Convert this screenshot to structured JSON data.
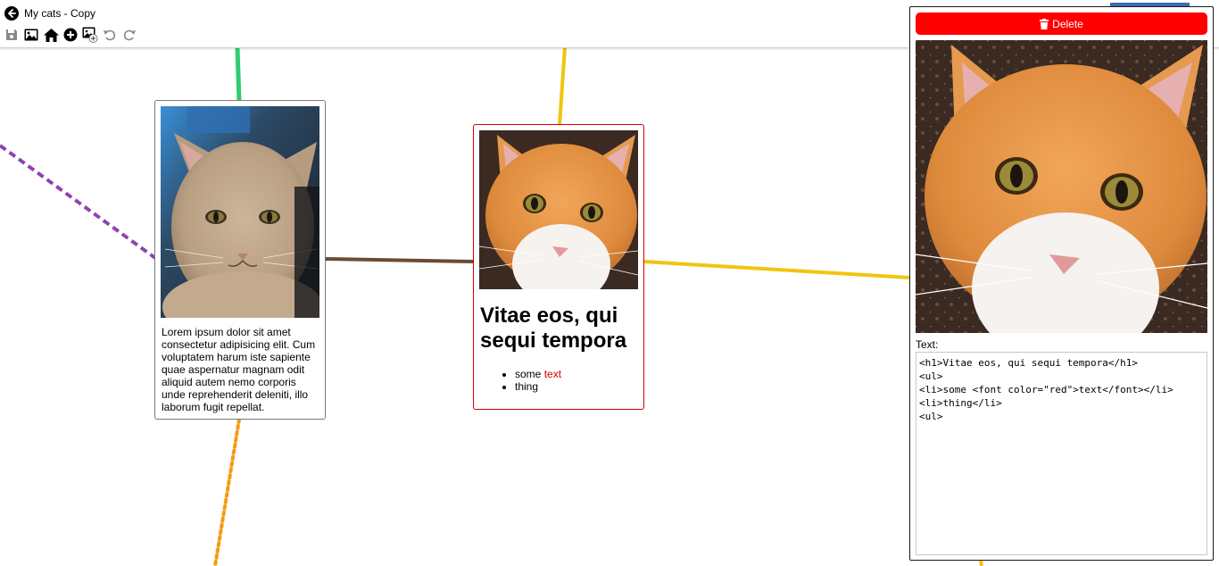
{
  "header": {
    "title": "My cats - Copy",
    "toolbar": [
      {
        "name": "save",
        "icon": "save-icon",
        "enabled": false
      },
      {
        "name": "image",
        "icon": "image-icon",
        "enabled": true
      },
      {
        "name": "home",
        "icon": "home-icon",
        "enabled": true
      },
      {
        "name": "add",
        "icon": "add-circle-icon",
        "enabled": true
      },
      {
        "name": "add-image",
        "icon": "add-image-icon",
        "enabled": true
      },
      {
        "name": "undo",
        "icon": "undo-icon",
        "enabled": false
      },
      {
        "name": "redo",
        "icon": "redo-icon",
        "enabled": false
      }
    ]
  },
  "cards": {
    "left": {
      "text": "Lorem ipsum dolor sit amet consectetur adipisicing elit. Cum voluptatem harum iste sapiente quae aspernatur magnam odit aliquid autem nemo corporis unde reprehenderit deleniti, illo laborum fugit repellat."
    },
    "center": {
      "heading": "Vitae eos, qui sequi tempora",
      "items": [
        {
          "prefix": "some ",
          "red": "text"
        },
        {
          "prefix": "thing",
          "red": ""
        }
      ]
    }
  },
  "panel": {
    "delete_label": "Delete",
    "text_label": "Text:",
    "editor_value": "<h1>Vitae eos, qui sequi tempora</h1>\n<ul>\n<li>some <font color=\"red\">text</font></li>\n<li>thing</li>\n<ul>"
  },
  "colors": {
    "delete": "#ff0000",
    "selected_border": "#d40000",
    "link_green": "#2ecc71",
    "link_yellow": "#f1c40f",
    "link_brown": "#6b4a34",
    "link_purple": "#8e44ad",
    "link_orange": "#f39c12",
    "accent_blue": "#3b6db3"
  }
}
